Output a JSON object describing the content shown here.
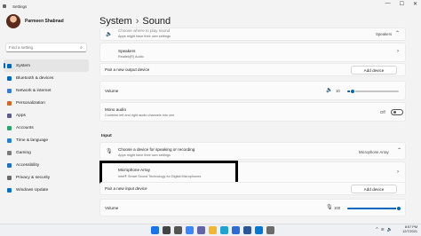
{
  "window": {
    "title": "Settings",
    "controls": [
      "—",
      "☐",
      "✕"
    ]
  },
  "profile": {
    "name": "Parmeen Shabnad",
    "email": ""
  },
  "search": {
    "placeholder": "Find a setting",
    "icon": "search-icon"
  },
  "sidebar": {
    "items": [
      {
        "label": "System",
        "active": true,
        "color": "#0067c0"
      },
      {
        "label": "Bluetooth & devices",
        "color": "#0067c0"
      },
      {
        "label": "Network & internet",
        "color": "#3c7bd6"
      },
      {
        "label": "Personalization",
        "color": "#d06a2a"
      },
      {
        "label": "Apps",
        "color": "#5b5b8b"
      },
      {
        "label": "Accounts",
        "color": "#2fa36b"
      },
      {
        "label": "Time & language",
        "color": "#2a7fd4"
      },
      {
        "label": "Gaming",
        "color": "#7a7a7a"
      },
      {
        "label": "Accessibility",
        "color": "#1f6ec9"
      },
      {
        "label": "Privacy & security",
        "color": "#6b6b6b"
      },
      {
        "label": "Windows Update",
        "color": "#0b72c9"
      }
    ]
  },
  "header": {
    "crumb": "System",
    "separator": "›",
    "page": "Sound"
  },
  "output": {
    "top_row": {
      "title": "Choose where to play sound",
      "subtitle": "Apps might have their own settings",
      "right": "Speakers"
    },
    "device": {
      "title": "Speakers",
      "subtitle": "Realtek(R) Audio"
    },
    "pair": {
      "label": "Pair a new output device",
      "button": "Add device"
    },
    "volume": {
      "label": "Volume",
      "value": "10",
      "level": 0.1
    },
    "mono": {
      "title": "Mono audio",
      "subtitle": "Combine left and right audio channels into one",
      "state": "Off"
    }
  },
  "input": {
    "section_label": "Input",
    "choose": {
      "title": "Choose a device for speaking or recording",
      "subtitle": "Apps might have their own settings",
      "right": "Microphone Array"
    },
    "device": {
      "title": "Microphone Array",
      "subtitle": "Intel® Smart Sound Technology for Digital Microphones"
    },
    "pair": {
      "label": "Pair a new input device",
      "button": "Add device"
    },
    "volume": {
      "label": "Volume",
      "value": "100",
      "level": 1.0
    }
  },
  "taskbar": {
    "time": "8:57 PM",
    "date": "12/7/2021",
    "icons": [
      {
        "name": "start-icon",
        "color": "#1a73e8"
      },
      {
        "name": "search-icon",
        "color": "#444444"
      },
      {
        "name": "task-view-icon",
        "color": "#555555"
      },
      {
        "name": "widgets-icon",
        "color": "#3a86ff"
      },
      {
        "name": "chat-icon",
        "color": "#6264a7"
      },
      {
        "name": "file-explorer-icon",
        "color": "#f2b631"
      },
      {
        "name": "edge-icon",
        "color": "#1fa3d1"
      },
      {
        "name": "store-icon",
        "color": "#2b6cd6"
      },
      {
        "name": "word-icon",
        "color": "#2b579a"
      },
      {
        "name": "mail-icon",
        "color": "#0078d4"
      },
      {
        "name": "settings-icon",
        "color": "#6b6b6b"
      }
    ]
  }
}
